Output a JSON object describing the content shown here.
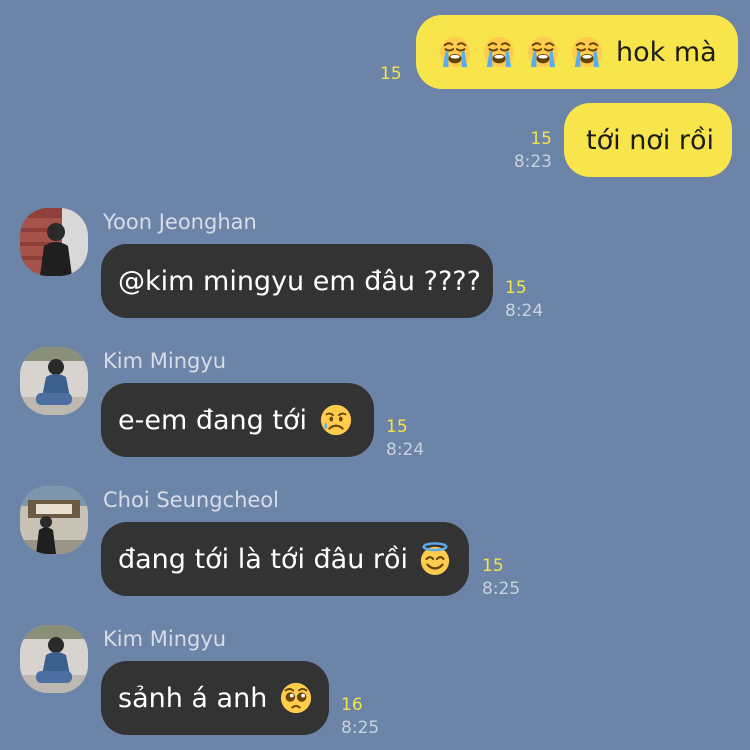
{
  "messages": [
    {
      "side": "out",
      "text": "hok mà",
      "emojis": [
        "loudly-crying-face",
        "loudly-crying-face",
        "loudly-crying-face",
        "loudly-crying-face"
      ],
      "read_count": "15",
      "time": ""
    },
    {
      "side": "out",
      "text": "tới nơi rồi",
      "read_count": "15",
      "time": "8:23"
    },
    {
      "side": "in",
      "sender": "Yoon Jeonghan",
      "avatar": "avatar-yoon-jeonghan",
      "text": "@kim mingyu em đâu ????",
      "read_count": "15",
      "time": "8:24"
    },
    {
      "side": "in",
      "sender": "Kim Mingyu",
      "avatar": "avatar-kim-mingyu",
      "text": "e-em đang tới",
      "emoji": "sad-but-relieved-face",
      "read_count": "15",
      "time": "8:24"
    },
    {
      "side": "in",
      "sender": "Choi Seungcheol",
      "avatar": "avatar-choi-seungcheol",
      "text": "đang tới là tới đâu rồi",
      "emoji": "smiling-face-with-halo",
      "read_count": "15",
      "time": "8:25"
    },
    {
      "side": "in",
      "sender": "Kim Mingyu",
      "avatar": "avatar-kim-mingyu",
      "text": "sảnh á anh",
      "emoji": "pleading-face",
      "read_count": "16",
      "time": "8:25"
    }
  ],
  "colors": {
    "background": "#6c84a8",
    "outgoing_bubble": "#f8e54c",
    "incoming_bubble": "#333334",
    "read_count": "#f3e34c",
    "timestamp": "#c8d2e0",
    "sender_name": "#d6dde8"
  }
}
